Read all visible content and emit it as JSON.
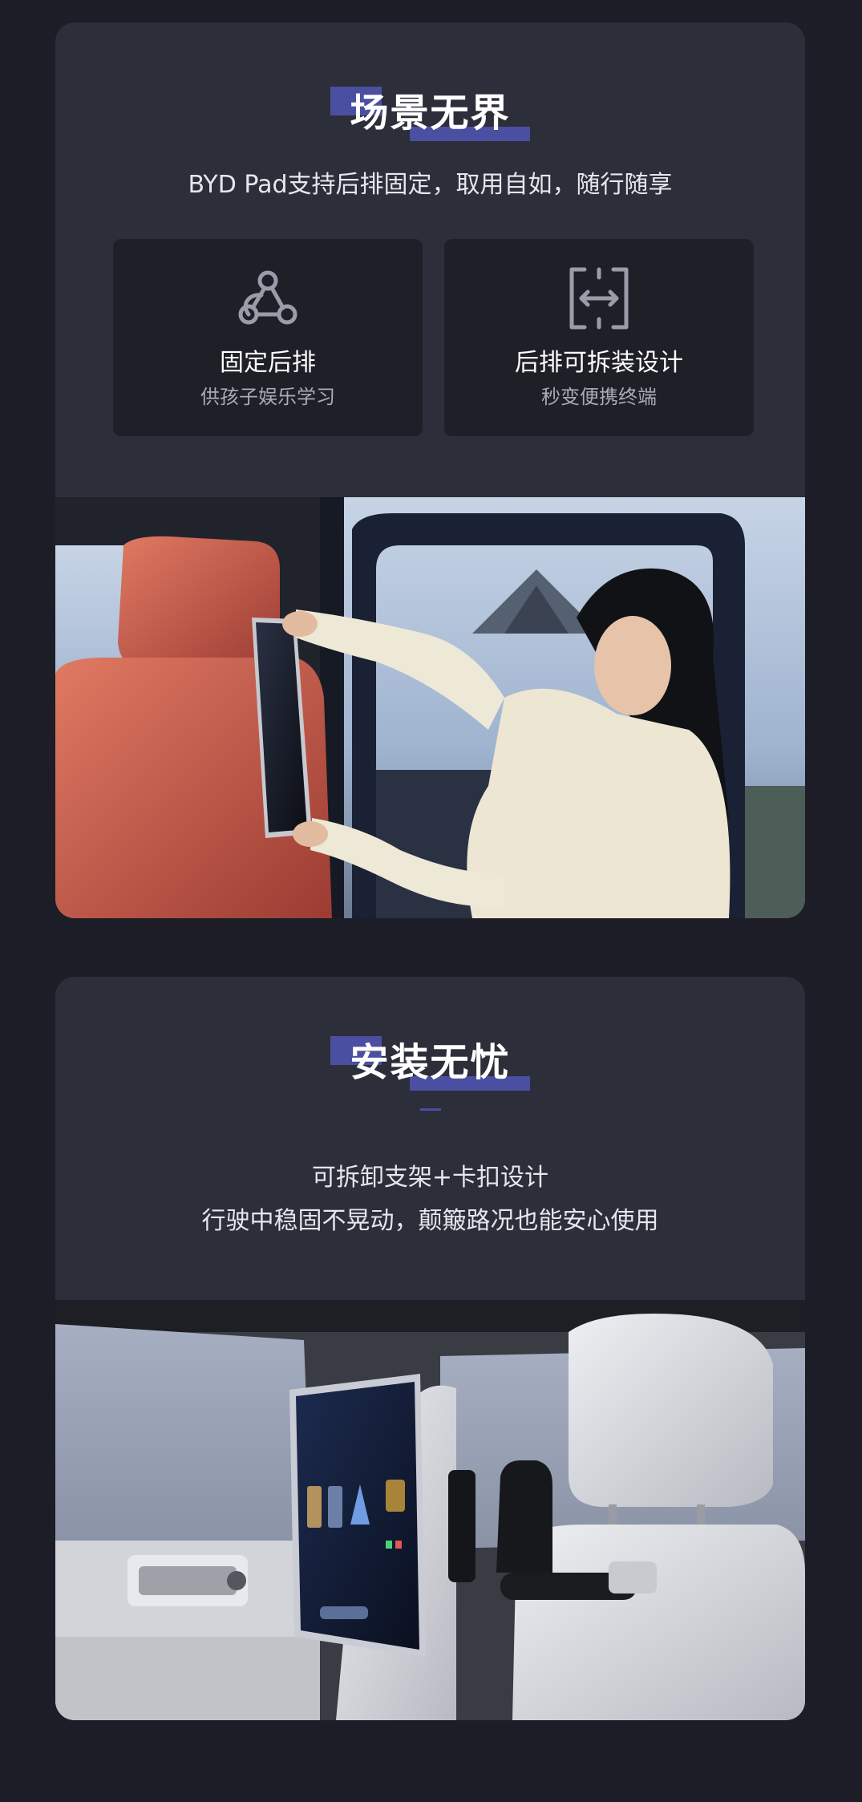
{
  "section1": {
    "title": "场景无界",
    "subtitle": "BYD Pad支持后排固定，取用自如，随行随享",
    "features": [
      {
        "icon": "webhook-icon",
        "title": "固定后排",
        "desc": "供孩子娱乐学习"
      },
      {
        "icon": "expand-arrows-icon",
        "title": "后排可拆装设计",
        "desc": "秒变便携终端"
      }
    ]
  },
  "section2": {
    "title": "安装无忧",
    "lines": [
      "可拆卸支架+卡扣设计",
      "行驶中稳固不晃动，颠簸路况也能安心使用"
    ]
  },
  "colors": {
    "background": "#1c1d26",
    "card": "#2c2e39",
    "feature_card": "#1e1f27",
    "accent": "#4b4fa1",
    "seat_red": "#c9584a",
    "seat_white": "#dcdde2"
  }
}
